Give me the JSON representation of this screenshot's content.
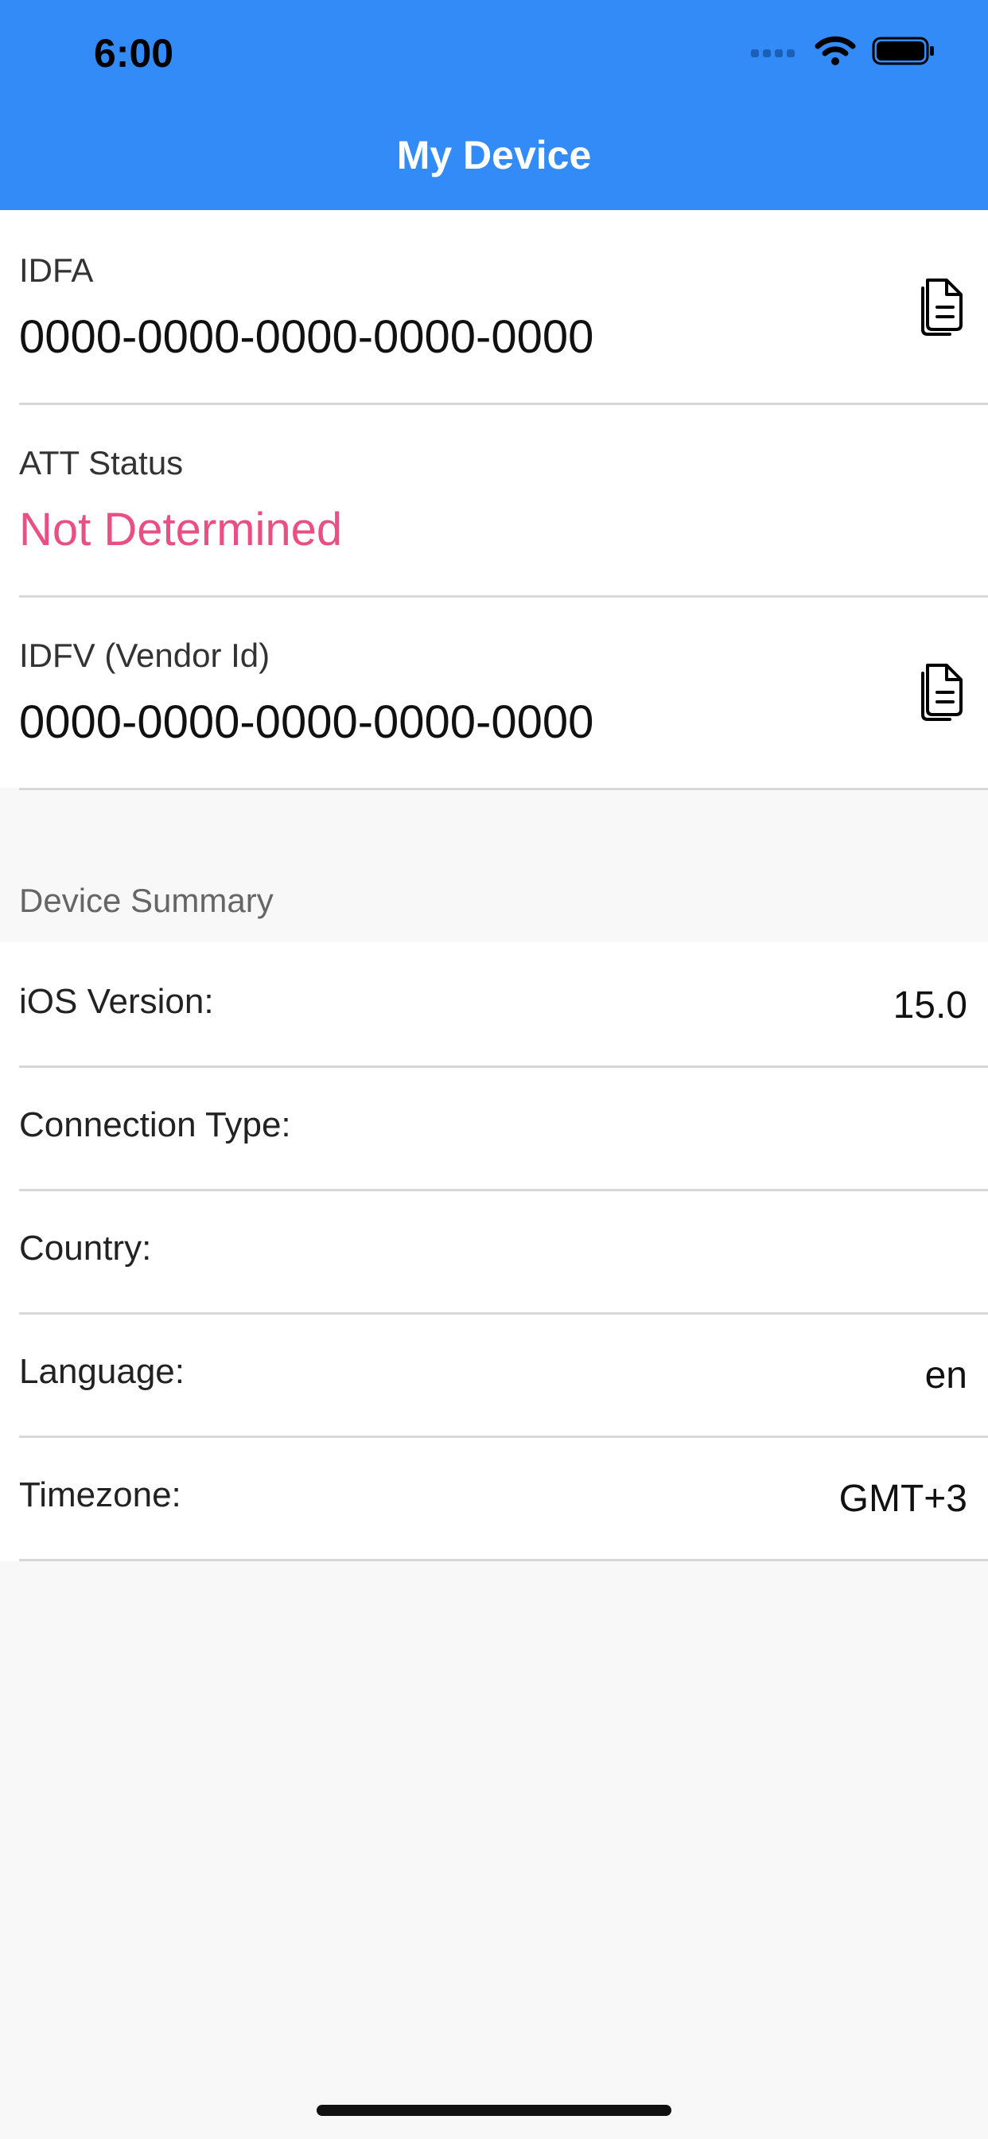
{
  "status_bar": {
    "time": "6:00"
  },
  "nav": {
    "title": "My Device"
  },
  "identifiers": [
    {
      "label": "IDFA",
      "value": "0000-0000-0000-0000-0000",
      "copyable": true,
      "value_color": "#111111"
    },
    {
      "label": "ATT Status",
      "value": "Not Determined",
      "copyable": false,
      "value_color": "#e94f83"
    },
    {
      "label": "IDFV (Vendor Id)",
      "value": "0000-0000-0000-0000-0000",
      "copyable": true,
      "value_color": "#111111"
    }
  ],
  "summary": {
    "title": "Device Summary",
    "rows": [
      {
        "label": "iOS Version:",
        "value": "15.0"
      },
      {
        "label": "Connection Type:",
        "value": ""
      },
      {
        "label": "Country:",
        "value": ""
      },
      {
        "label": "Language:",
        "value": "en"
      },
      {
        "label": "Timezone:",
        "value": "GMT+3"
      }
    ]
  },
  "colors": {
    "header": "#338bf7",
    "accent_pink": "#e94f83"
  },
  "icons": [
    "cellular-signal-icon",
    "wifi-icon",
    "battery-icon",
    "copy-icon"
  ]
}
